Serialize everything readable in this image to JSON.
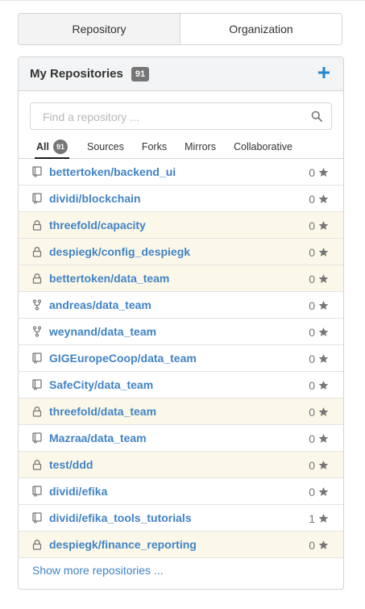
{
  "tabs": {
    "repository": "Repository",
    "organization": "Organization"
  },
  "panel": {
    "title": "My Repositories",
    "count": "91"
  },
  "search": {
    "placeholder": "Find a repository ..."
  },
  "filters": [
    {
      "label": "All",
      "badge": "91"
    },
    {
      "label": "Sources"
    },
    {
      "label": "Forks"
    },
    {
      "label": "Mirrors"
    },
    {
      "label": "Collaborative"
    }
  ],
  "repos": [
    {
      "name": "bettertoken/backend_ui",
      "stars": "0",
      "type": "repo"
    },
    {
      "name": "dividi/blockchain",
      "stars": "0",
      "type": "repo"
    },
    {
      "name": "threefold/capacity",
      "stars": "0",
      "type": "private"
    },
    {
      "name": "despiegk/config_despiegk",
      "stars": "0",
      "type": "private"
    },
    {
      "name": "bettertoken/data_team",
      "stars": "0",
      "type": "private"
    },
    {
      "name": "andreas/data_team",
      "stars": "0",
      "type": "fork"
    },
    {
      "name": "weynand/data_team",
      "stars": "0",
      "type": "fork"
    },
    {
      "name": "GIGEuropeCoop/data_team",
      "stars": "0",
      "type": "repo"
    },
    {
      "name": "SafeCity/data_team",
      "stars": "0",
      "type": "repo"
    },
    {
      "name": "threefold/data_team",
      "stars": "0",
      "type": "private"
    },
    {
      "name": "Mazraa/data_team",
      "stars": "0",
      "type": "repo"
    },
    {
      "name": "test/ddd",
      "stars": "0",
      "type": "private"
    },
    {
      "name": "dividi/efika",
      "stars": "0",
      "type": "repo"
    },
    {
      "name": "dividi/efika_tools_tutorials",
      "stars": "1",
      "type": "repo"
    },
    {
      "name": "despiegk/finance_reporting",
      "stars": "0",
      "type": "private"
    }
  ],
  "show_more": "Show more repositories ...",
  "colors": {
    "link": "#4183c4",
    "private_row": "#fcf8e9",
    "badge": "#767676"
  },
  "icons": {
    "repo": "book-icon",
    "private": "lock-icon",
    "fork": "fork-icon",
    "star": "star-icon",
    "add": "plus-icon",
    "search": "search-icon"
  }
}
